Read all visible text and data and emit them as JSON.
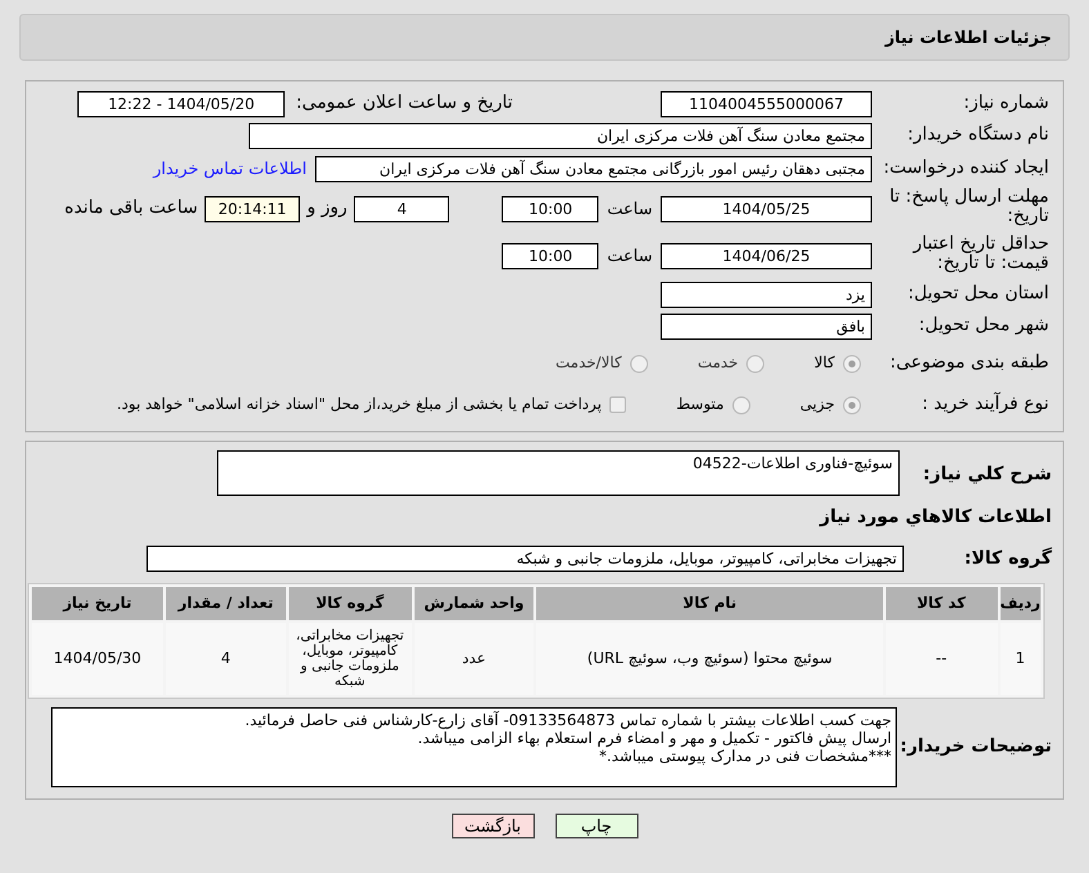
{
  "header": {
    "title": "جزئیات اطلاعات نیاز"
  },
  "need_number": {
    "label": "شماره نیاز:",
    "value": "1104004555000067"
  },
  "announce": {
    "label": "تاریخ و ساعت اعلان عمومی:",
    "value": "1404/05/20 - 12:22"
  },
  "buyer": {
    "label": "نام دستگاه خریدار:",
    "value": "مجتمع معادن سنگ آهن فلات مرکزی ایران"
  },
  "requester": {
    "label": "ایجاد کننده درخواست:",
    "value": "مجتبی  دهقان رئیس امور بازرگانی مجتمع معادن سنگ آهن فلات مرکزی ایران",
    "link": "اطلاعات تماس خریدار"
  },
  "reply_deadline": {
    "label": "مهلت ارسال پاسخ: تا تاریخ:",
    "date": "1404/05/25",
    "time_label": "ساعت",
    "time": "10:00",
    "days": "4",
    "days_label": "روز و",
    "remaining": "20:14:11",
    "remaining_label": "ساعت باقی مانده"
  },
  "price_validity": {
    "label": "حداقل تاریخ اعتبار قیمت: تا تاریخ:",
    "date": "1404/06/25",
    "time_label": "ساعت",
    "time": "10:00"
  },
  "province": {
    "label": "استان محل تحویل:",
    "value": "یزد"
  },
  "city": {
    "label": "شهر محل تحویل:",
    "value": "بافق"
  },
  "category": {
    "label": "طبقه بندی موضوعی:",
    "options": [
      {
        "label": "کالا",
        "selected": true
      },
      {
        "label": "خدمت",
        "selected": false
      },
      {
        "label": "کالا/خدمت",
        "selected": false
      }
    ]
  },
  "process": {
    "label": "نوع فرآیند خرید :",
    "options": [
      {
        "label": "جزیی",
        "selected": true
      },
      {
        "label": "متوسط",
        "selected": false
      }
    ],
    "payment": {
      "label": "پرداخت تمام یا بخشی از مبلغ خرید،از محل \"اسناد خزانه اسلامی\" خواهد بود.",
      "checked": false
    }
  },
  "description": {
    "label": "شرح كلي نياز:",
    "value": "سوئیچ-فناوری اطلاعات-04522"
  },
  "goods_title": "اطلاعات كالاهاي مورد نياز",
  "goods_group": {
    "label": "گروه کالا:",
    "value": "تجهیزات مخابراتی، کامپیوتر، موبایل، ملزومات جانبی و شبکه"
  },
  "table": {
    "columns": [
      "ردیف",
      "کد کالا",
      "نام کالا",
      "واحد شمارش",
      "گروه کالا",
      "تعداد / مقدار",
      "تاریخ نیاز"
    ],
    "rows": [
      {
        "cells": [
          "1",
          "--",
          "سوئیچ محتوا (سوئیچ وب، سوئیچ URL)",
          "عدد",
          "تجهیزات مخابراتی، کامپیوتر، موبایل، ملزومات جانبی و شبکه",
          "4",
          "1404/05/30"
        ]
      }
    ]
  },
  "buyer_notes": {
    "label": "توضیحات خریدار:",
    "lines": [
      "جهت کسب اطلاعات بیشتر با شماره تماس 09133564873- آقای زارع-کارشناس فنی حاصل فرمائید.",
      "ارسال پیش فاکتور - تکمیل و مهر و امضاء فرم استعلام بهاء الزامی میباشد.",
      "***مشخصات فنی در مدارک پیوستی میباشد.*"
    ]
  },
  "buttons": [
    {
      "label": "چاپ",
      "kind": "print"
    },
    {
      "label": "بازگشت",
      "kind": "back"
    }
  ]
}
